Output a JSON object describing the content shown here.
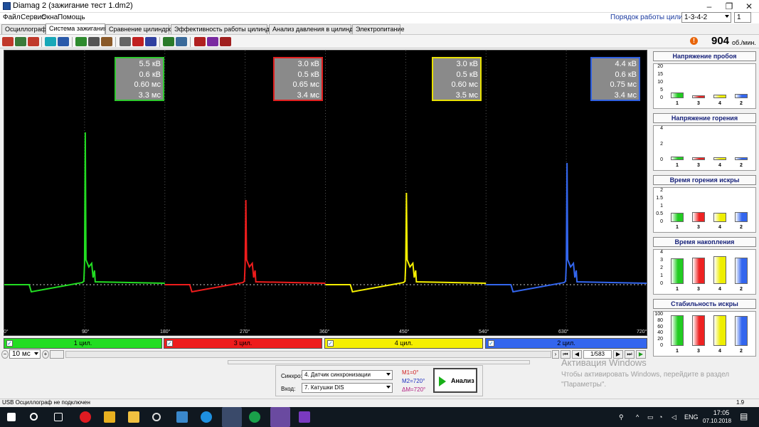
{
  "window": {
    "title": "Diamag 2 (зажигание тест 1.dm2)"
  },
  "menu": [
    "Файл",
    "Сервис",
    "Окна",
    "Помощь"
  ],
  "cylinder_order": {
    "label": "Порядок работы цилиндров",
    "value": "1-3-4-2",
    "spin_value": "1"
  },
  "tabs": [
    "Осциллограф",
    "Система зажигания",
    "Сравнение цилиндров",
    "Эффективность работы цилиндров",
    "Анализ давления в цилиндре",
    "Электропитание"
  ],
  "active_tab": 1,
  "rpm": {
    "value": "904",
    "unit": "об./мин."
  },
  "readouts": [
    {
      "lines": [
        "5.5 кВ",
        "0.6 кВ",
        "0.60 мс",
        "3.3 мс"
      ],
      "color": "#2ec82e"
    },
    {
      "lines": [
        "3.0 кВ",
        "0.5 кВ",
        "0.65 мс",
        "3.4 мс"
      ],
      "color": "#e02020"
    },
    {
      "lines": [
        "3.0 кВ",
        "0.5 кВ",
        "0.60 мс",
        "3.5 мс"
      ],
      "color": "#e8e000"
    },
    {
      "lines": [
        "4.4 кВ",
        "0.6 кВ",
        "0.75 мс",
        "3.4 мс"
      ],
      "color": "#3060e0"
    }
  ],
  "degree_labels": [
    "0°",
    "90°",
    "180°",
    "270°",
    "360°",
    "450°",
    "540°",
    "630°",
    "720°"
  ],
  "cylinders": [
    {
      "label": "1 цил.",
      "color": "#22dd22"
    },
    {
      "label": "3 цил.",
      "color": "#ee1c1c"
    },
    {
      "label": "4 цил.",
      "color": "#f5ef00"
    },
    {
      "label": "2 цил.",
      "color": "#3366ee"
    }
  ],
  "zoom": {
    "value": "10 мс"
  },
  "page": {
    "value": "1/583"
  },
  "panels": [
    {
      "title": "Напряжение пробоя",
      "yticks": [
        "20",
        "15",
        "10",
        "5",
        "0"
      ],
      "ymax": 20,
      "values": [
        3.5,
        2.0,
        2.2,
        2.8
      ]
    },
    {
      "title": "Напряжение горения",
      "yticks": [
        "4",
        "2",
        "0"
      ],
      "ymax": 5,
      "values": [
        0.6,
        0.5,
        0.5,
        0.5
      ]
    },
    {
      "title": "Время горения искры",
      "yticks": [
        "2",
        "1.5",
        "1",
        "0.5",
        "0"
      ],
      "ymax": 2,
      "values": [
        0.6,
        0.65,
        0.6,
        0.65
      ]
    },
    {
      "title": "Время накопления",
      "yticks": [
        "4",
        "3",
        "2",
        "1",
        "0"
      ],
      "ymax": 4,
      "values": [
        3.3,
        3.4,
        3.5,
        3.4
      ]
    },
    {
      "title": "Стабильность искры",
      "yticks": [
        "100",
        "80",
        "60",
        "40",
        "20",
        "0"
      ],
      "ymax": 100,
      "values": [
        98,
        98,
        97,
        96
      ]
    }
  ],
  "panel_xlabels": [
    "1",
    "3",
    "4",
    "2"
  ],
  "panel_colors": [
    "#22cc22",
    "#ee2222",
    "#eeee00",
    "#3366ee"
  ],
  "controls": {
    "sync_label": "Синхро:",
    "sync_value": "4. Датчик синхронизации",
    "input_label": "Вход:",
    "input_value": "7. Катушки DIS",
    "m1": "M1=0°",
    "m2": "M2=720°",
    "dm": "ΔM=720°",
    "analyze": "Анализ"
  },
  "watermark": {
    "line1": "Активация Windows",
    "line2": "Чтобы активировать Windows, перейдите в раздел \"Параметры\"."
  },
  "status": {
    "left": "USB Осциллограф не подключен",
    "right": "1.9"
  },
  "taskbar": {
    "lang": "ENG",
    "time": "17:05",
    "date": "07.10.2018"
  }
}
